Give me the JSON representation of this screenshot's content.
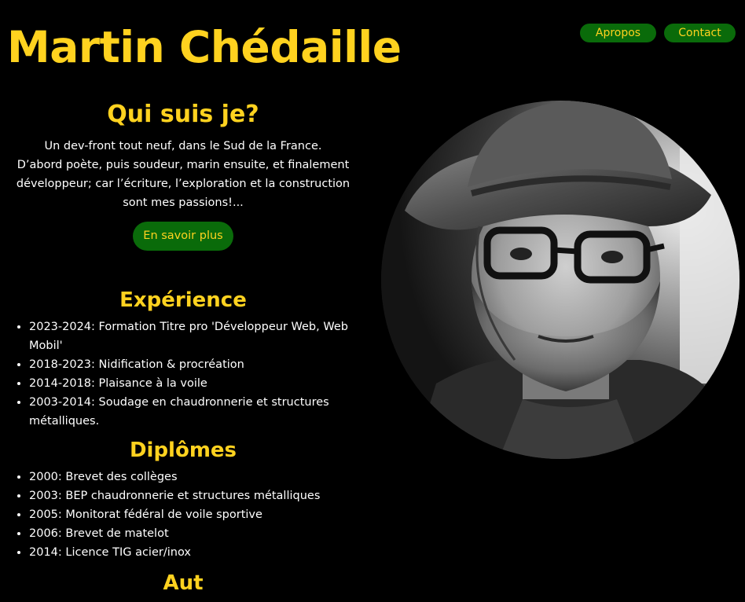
{
  "header": {
    "title": "Martin Chédaille",
    "nav": [
      {
        "label": "Apropos"
      },
      {
        "label": "Contact"
      }
    ]
  },
  "about": {
    "title": "Qui suis je?",
    "line1": "Un dev-front tout neuf, dans le Sud de la France.",
    "line2": "D’abord poète, puis soudeur, marin ensuite, et finalement développeur; car l’écriture, l’exploration et la construction sont mes passions!...",
    "cta": "En savoir plus"
  },
  "experience": {
    "title": "Expérience",
    "items": [
      "2023-2024: Formation Titre pro 'Développeur Web, Web Mobil'",
      "2018-2023: Nidification & procréation",
      "2014-2018: Plaisance à la voile",
      "2003-2014: Soudage en chaudronnerie et structures métalliques."
    ]
  },
  "diplomas": {
    "title": "Diplômes",
    "items": [
      "2000: Brevet des collèges",
      "2003: BEP chaudronnerie et structures métalliques",
      "2005: Monitorat fédéral de voile sportive",
      "2006: Brevet de matelot",
      "2014: Licence TIG acier/inox"
    ]
  },
  "next_section": {
    "title": "Aut"
  },
  "colors": {
    "accent": "#ffd21f",
    "button_bg": "#0a6b0a",
    "background": "#000000"
  }
}
